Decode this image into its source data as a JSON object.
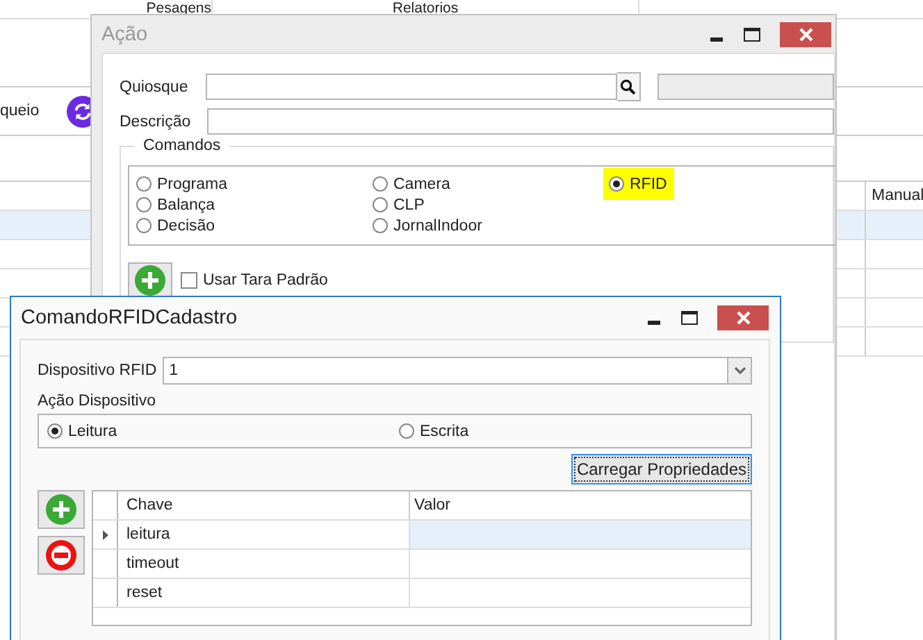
{
  "background": {
    "columns": [
      "Pesagens",
      "Relatorios"
    ],
    "label": "queio",
    "table": {
      "columns": [
        "Manual"
      ],
      "rows": [
        {
          "selected": true
        },
        {
          "selected": false
        },
        {
          "selected": false
        },
        {
          "selected": false
        },
        {
          "selected": false
        }
      ]
    }
  },
  "acao_window": {
    "title": "Ação",
    "fields": [
      {
        "label": "Quiosque",
        "kind": "lookup"
      },
      {
        "label": "Descrição",
        "kind": "text"
      }
    ],
    "commands": {
      "title": "Comandos",
      "options": [
        {
          "label": "Programa",
          "selected": false,
          "highlighted": false
        },
        {
          "label": "Balança",
          "selected": false,
          "highlighted": false
        },
        {
          "label": "Decisão",
          "selected": false,
          "highlighted": false
        },
        {
          "label": "Camera",
          "selected": false,
          "highlighted": false
        },
        {
          "label": "CLP",
          "selected": false,
          "highlighted": false
        },
        {
          "label": "JornalIndoor",
          "selected": false,
          "highlighted": false
        },
        {
          "label": "RFID",
          "selected": true,
          "highlighted": true
        }
      ]
    },
    "checkbox": {
      "label": "Usar Tara Padrão",
      "checked": false
    }
  },
  "rfid_window": {
    "title": "ComandoRFIDCadastro",
    "device": {
      "label": "Dispositivo RFID",
      "value": "1"
    },
    "action": {
      "label": "Ação Dispositivo",
      "options": [
        {
          "label": "Leitura",
          "selected": true
        },
        {
          "label": "Escrita",
          "selected": false
        }
      ]
    },
    "load_button": "Carregar Propriedades",
    "grid": {
      "columns": [
        "Chave",
        "Valor"
      ],
      "rows": [
        {
          "key": "leitura",
          "selected": true
        },
        {
          "key": "timeout",
          "selected": false
        },
        {
          "key": "reset",
          "selected": false
        }
      ]
    }
  }
}
